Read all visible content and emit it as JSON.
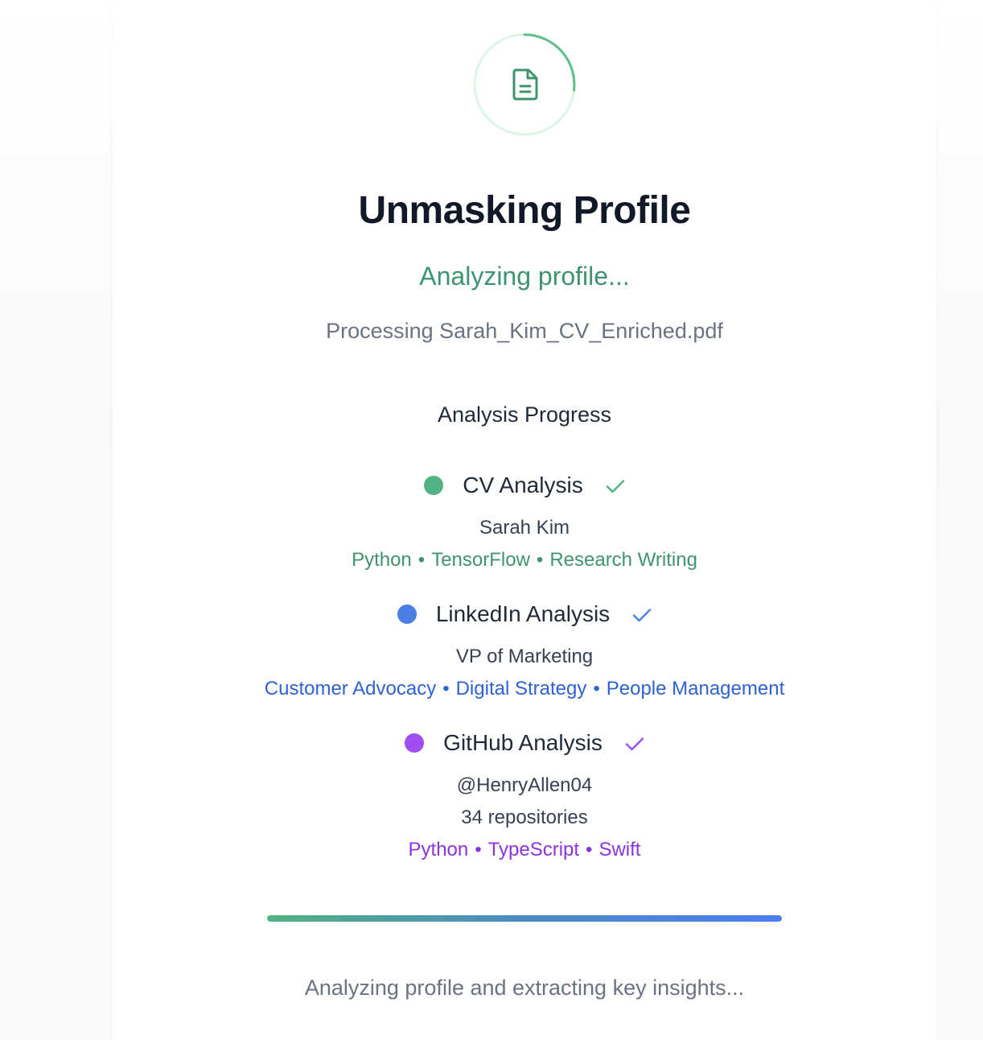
{
  "header": {
    "title": "Unmasking Profile",
    "status": "Analyzing profile...",
    "processing": "Processing Sarah_Kim_CV_Enriched.pdf"
  },
  "progress": {
    "heading": "Analysis Progress",
    "fraction": 1.0,
    "footer": "Analyzing profile and extracting key insights..."
  },
  "steps": {
    "cv": {
      "label": "CV Analysis",
      "color": "#52b283",
      "name": "Sarah Kim",
      "tags": [
        "Python",
        "TensorFlow",
        "Research Writing"
      ]
    },
    "linkedin": {
      "label": "LinkedIn Analysis",
      "color": "#4a7fe6",
      "title": "VP of Marketing",
      "tags": [
        "Customer Advocacy",
        "Digital Strategy",
        "People Management"
      ]
    },
    "github": {
      "label": "GitHub Analysis",
      "color": "#a14ef0",
      "handle": "@HenryAllen04",
      "repos": "34 repositories",
      "tags": [
        "Python",
        "TypeScript",
        "Swift"
      ]
    }
  },
  "icons": {
    "spinner": "loading-ring-icon",
    "document": "document-icon",
    "check": "check-icon"
  },
  "colors": {
    "accent_green": "#3e9470",
    "accent_blue": "#2f62d4",
    "accent_purple": "#8a34e0"
  },
  "separator": "•"
}
